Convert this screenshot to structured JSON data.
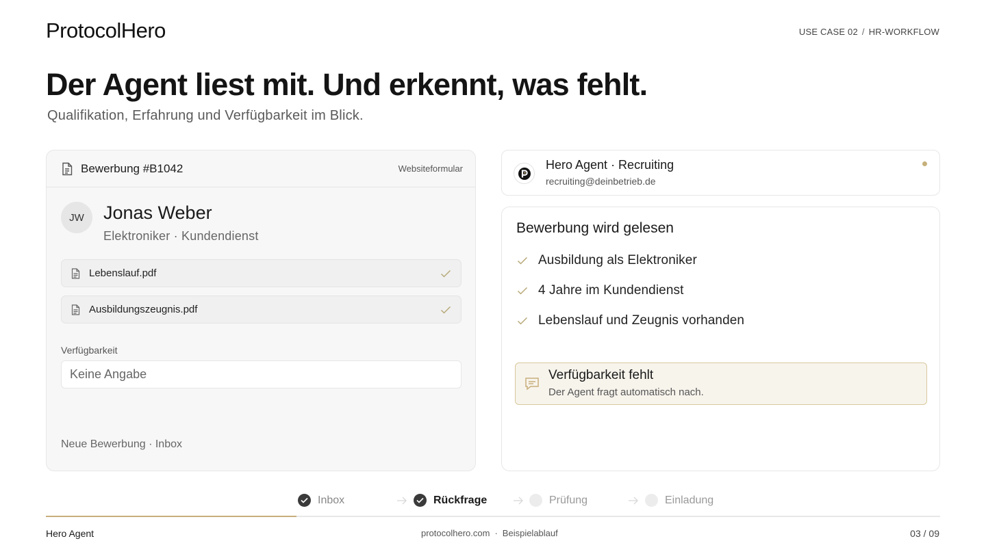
{
  "header": {
    "logo": "ProtocolHero",
    "usecase": "USE CASE 02",
    "separator": "/",
    "workflow": "HR-WORKFLOW"
  },
  "hero": {
    "headline": "Der Agent liest mit. Und erkennt, was fehlt.",
    "subline": "Qualifikation, Erfahrung und Verfügbarkeit im Blick."
  },
  "application": {
    "title": "Bewerbung #B1042",
    "source": "Websiteformular",
    "avatar_initials": "JW",
    "name": "Jonas Weber",
    "role": "Elektroniker · Kundendienst",
    "files": [
      {
        "name": "Lebenslauf.pdf",
        "status": "ok"
      },
      {
        "name": "Ausbildungszeugnis.pdf",
        "status": "ok"
      }
    ],
    "availability_label": "Verfügbarkeit",
    "availability_value": "Keine Angabe",
    "footer": "Neue Bewerbung · Inbox"
  },
  "agent": {
    "name": "Hero Agent · Recruiting",
    "email": "recruiting@deinbetrieb.de",
    "status_color": "#c5b07a"
  },
  "reading": {
    "title": "Bewerbung wird gelesen",
    "checks": [
      "Ausbildung als Elektroniker",
      "4 Jahre im Kundendienst",
      "Lebenslauf und Zeugnis vorhanden"
    ],
    "alert_title": "Verfügbarkeit fehlt",
    "alert_text": "Der Agent fragt automatisch nach."
  },
  "steps": [
    {
      "label": "Inbox",
      "state": "done"
    },
    {
      "label": "Rückfrage",
      "state": "active"
    },
    {
      "label": "Prüfung",
      "state": "todo"
    },
    {
      "label": "Einladung",
      "state": "todo"
    }
  ],
  "progress_fraction": 0.28,
  "footer": {
    "left": "Hero Agent",
    "site": "protocolhero.com",
    "separator": "·",
    "label": "Beispielablauf",
    "page": "03 / 09"
  },
  "colors": {
    "accent": "#c9ae7c",
    "check": "#b7a978",
    "alert_border": "#d8c89b"
  }
}
